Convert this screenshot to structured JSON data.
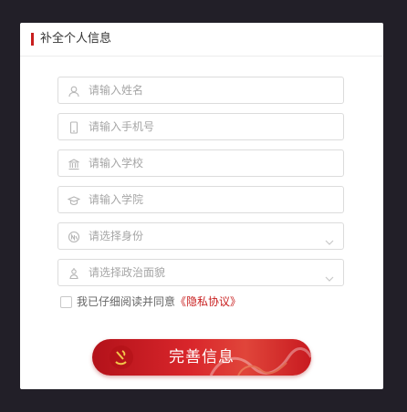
{
  "header": {
    "title": "补全个人信息"
  },
  "form": {
    "name_placeholder": "请输入姓名",
    "phone_placeholder": "请输入手机号",
    "school_placeholder": "请输入学校",
    "college_placeholder": "请输入学院",
    "identity_placeholder": "请选择身份",
    "political_placeholder": "请选择政治面貌"
  },
  "agreement": {
    "prefix": "我已仔细阅读并同意",
    "link": "《隐私协议》",
    "checked": false
  },
  "submit": {
    "label": "完善信息"
  },
  "colors": {
    "accent": "#c81e1e",
    "background": "#221f28",
    "border": "#dcdcdc",
    "placeholder": "#a6a6a6"
  },
  "icons": [
    "user-icon",
    "phone-icon",
    "school-icon",
    "graduation-cap-icon",
    "identity-icon",
    "political-icon",
    "chevron-down-icon",
    "party-emblem-icon"
  ]
}
